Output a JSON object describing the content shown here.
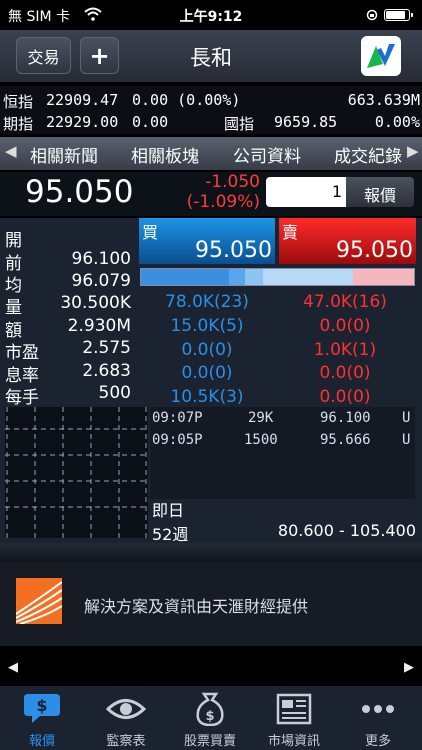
{
  "status": {
    "carrier": "無 SIM 卡",
    "time": "上午9:12"
  },
  "nav": {
    "trade_label": "交易",
    "add_label": "+",
    "title": "長和"
  },
  "indices": [
    {
      "label": "恒指",
      "value": "22909.47",
      "change": "0.00 (0.00%)",
      "turnover": "663.639M"
    },
    {
      "label": "期指",
      "value": "22929.00",
      "change": "0.00",
      "label2": "國指",
      "value2": "9659.85",
      "change2": "0.00%"
    }
  ],
  "tabs": [
    "相關新聞",
    "相關板塊",
    "公司資料",
    "成交紀錄"
  ],
  "quote": {
    "price": "95.050",
    "change": "-1.050",
    "change_pct": "(-1.09%)",
    "qty": "1",
    "quote_button": "報價"
  },
  "stats": [
    {
      "label": "開",
      "value": ""
    },
    {
      "label": "前",
      "value": "96.100"
    },
    {
      "label": "均",
      "value": "96.079"
    },
    {
      "label": "量",
      "value": "30.500K"
    },
    {
      "label": "額",
      "value": "2.930M"
    },
    {
      "label": "市盈",
      "value": "2.575"
    },
    {
      "label": "息率",
      "value": "2.683"
    },
    {
      "label": "每手",
      "value": "500"
    }
  ],
  "bid": {
    "label": "買",
    "price": "95.050"
  },
  "ask": {
    "label": "賣",
    "price": "95.050"
  },
  "depth": {
    "bids": [
      "78.0K(23)",
      "15.0K(5)",
      "0.0(0)",
      "0.0(0)",
      "10.5K(3)"
    ],
    "asks": [
      "47.0K(16)",
      "0.0(0)",
      "1.0K(1)",
      "0.0(0)",
      "0.0(0)"
    ]
  },
  "trades": [
    {
      "time": "09:07P",
      "vol": "29K",
      "price": "96.100",
      "flag": "U"
    },
    {
      "time": "09:05P",
      "vol": "1500",
      "price": "95.666",
      "flag": "U"
    }
  ],
  "range": {
    "day_label": "即日",
    "week_label": "52週",
    "week_range": "80.600 - 105.400"
  },
  "banner": {
    "text": "解決方案及資訊由天滙財經提供"
  },
  "tabbar": [
    {
      "label": "報價",
      "icon": "quote-bubble-icon"
    },
    {
      "label": "監察表",
      "icon": "eye-icon"
    },
    {
      "label": "股票買賣",
      "icon": "money-bag-icon"
    },
    {
      "label": "市場資訊",
      "icon": "newspaper-icon"
    },
    {
      "label": "更多",
      "icon": "more-dots-icon"
    }
  ],
  "colors": {
    "up": "#ff3030",
    "bid": "#2a8fe6",
    "active_tab": "#2d8ee8"
  }
}
